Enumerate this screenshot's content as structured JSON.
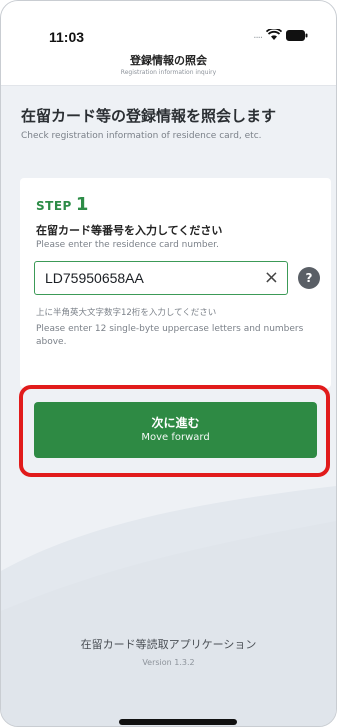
{
  "status_bar": {
    "time": "11:03",
    "dots": "....",
    "wifi_icon": "wifi-icon",
    "battery_icon": "battery-icon"
  },
  "nav": {
    "title_ja": "登録情報の照会",
    "title_en": "Registration information inquiry"
  },
  "hero": {
    "title_ja": "在留カード等の登録情報を照会します",
    "subtitle_en": "Check registration information of residence card, etc."
  },
  "card": {
    "step_label": "STEP",
    "step_number": "1",
    "label_ja": "在留カード等番号を入力してください",
    "label_en": "Please enter the residence card number.",
    "input_value": "LD75950658AA",
    "clear_icon": "×",
    "help_icon": "?",
    "hint_ja": "上に半角英大文字数字12桁を入力してください",
    "hint_en": "Please enter 12 single-byte uppercase letters and numbers above."
  },
  "button": {
    "label_ja": "次に進む",
    "label_en": "Move forward"
  },
  "footer": {
    "app_name": "在留カード等読取アプリケーション",
    "version": "Version 1.3.2"
  },
  "colors": {
    "accent": "#2e8a44",
    "highlight": "#e11b1b",
    "background": "#eef1f5"
  }
}
